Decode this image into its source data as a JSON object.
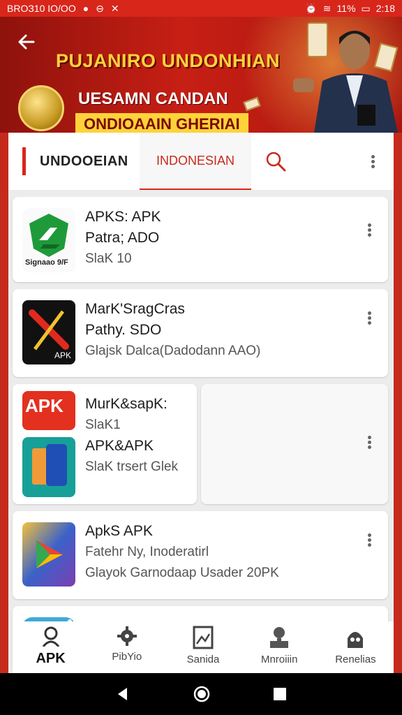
{
  "status_bar": {
    "left_text": "BROЗ10 IO/OO",
    "time": "2:18",
    "battery": "11%"
  },
  "banner": {
    "title": "PUJANIRO UNDONHIAN",
    "sub1": "UESAMN CANDAN",
    "sub2": "ONDIOAAIN GHERIAI"
  },
  "tabs": {
    "active": "UNDOOEIAN",
    "secondary": "INDONESIAN"
  },
  "apps": [
    {
      "title": "APKS: APK",
      "line2": "Patra; ADO",
      "line3": "SlaK 10",
      "icon_text": "Signaao 9/F",
      "icon": "green-shield-icon"
    },
    {
      "title": "MarK'SragCras",
      "line2": "Pathy. SDO",
      "line3": "Glajsk Dalca(Dadodann AAO)",
      "icon_text": "APK",
      "icon": "red-x-icon"
    },
    {
      "title": "MurK&sapK:",
      "line2": "SlaK1",
      "line3": "APK&APK",
      "line4": "SlaK trsert Glek",
      "icon_text": "APK",
      "icon": "apk-tablet-icon"
    },
    {
      "title": "ApkS APK",
      "line2": "Fatehr Ny, Inoderatirl",
      "line3": "Glayok Garnodaap Usader 20PK",
      "icon": "play-store-icon"
    },
    {
      "title": "",
      "icon": "paint-brush-icon"
    }
  ],
  "bottom_nav": [
    {
      "label": "APK",
      "icon": "person-search-icon",
      "active": true
    },
    {
      "label": "PibYio",
      "icon": "gear-bug-icon"
    },
    {
      "label": "Sanida",
      "icon": "image-frame-icon"
    },
    {
      "label": "Mnroiiin",
      "icon": "person-desk-icon"
    },
    {
      "label": "Renelias",
      "icon": "robot-icon"
    }
  ],
  "colors": {
    "accent": "#d8261b",
    "banner_text": "#ffd23a"
  }
}
